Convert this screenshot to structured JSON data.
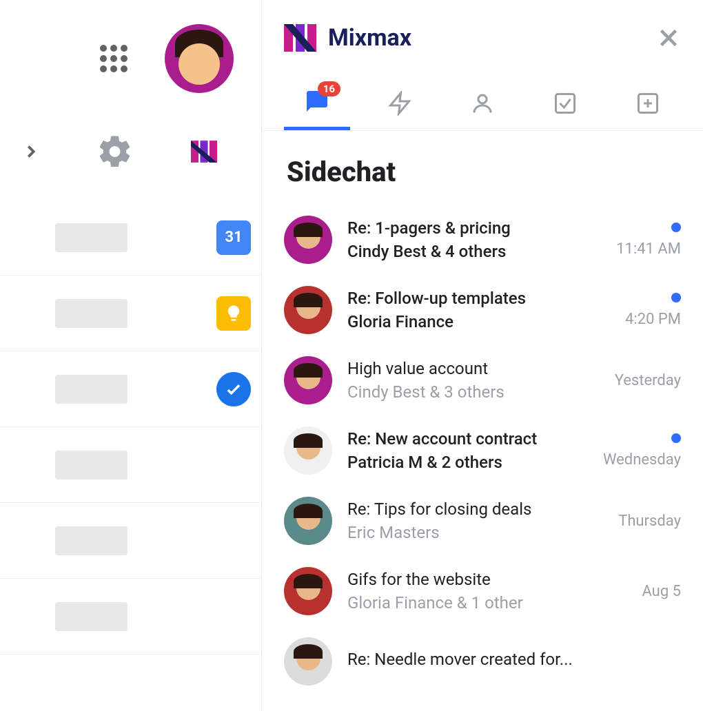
{
  "app": {
    "name": "Mixmax",
    "section_title": "Sidechat",
    "badge_count": "16"
  },
  "tabs": [
    {
      "id": "chat",
      "active": true
    },
    {
      "id": "lightning",
      "active": false
    },
    {
      "id": "person",
      "active": false
    },
    {
      "id": "checkbox",
      "active": false
    },
    {
      "id": "plus",
      "active": false
    }
  ],
  "side_apps": {
    "calendar_label": "31"
  },
  "chats": [
    {
      "subject": "Re: 1-pagers & pricing",
      "people": "Cindy Best & 4 others",
      "time": "11:41 AM",
      "unread": true,
      "read": false,
      "avatar_color": "purple"
    },
    {
      "subject": "Re: Follow-up templates",
      "people": "Gloria Finance",
      "time": "4:20 PM",
      "unread": true,
      "read": false,
      "avatar_color": "red"
    },
    {
      "subject": "High value account",
      "people": "Cindy Best & 3 others",
      "time": "Yesterday",
      "unread": false,
      "read": true,
      "avatar_color": "purple"
    },
    {
      "subject": "Re: New account contract",
      "people": "Patricia M & 2 others",
      "time": "Wednesday",
      "unread": true,
      "read": false,
      "avatar_color": "white"
    },
    {
      "subject": "Re: Tips for closing deals",
      "people": "Eric Masters",
      "time": "Thursday",
      "unread": false,
      "read": true,
      "avatar_color": "teal"
    },
    {
      "subject": "Gifs for the website",
      "people": "Gloria Finance & 1 other",
      "time": "Aug 5",
      "unread": false,
      "read": true,
      "avatar_color": "red"
    },
    {
      "subject": "Re: Needle mover created for...",
      "people": "",
      "time": "",
      "unread": false,
      "read": true,
      "avatar_color": "gray"
    }
  ]
}
